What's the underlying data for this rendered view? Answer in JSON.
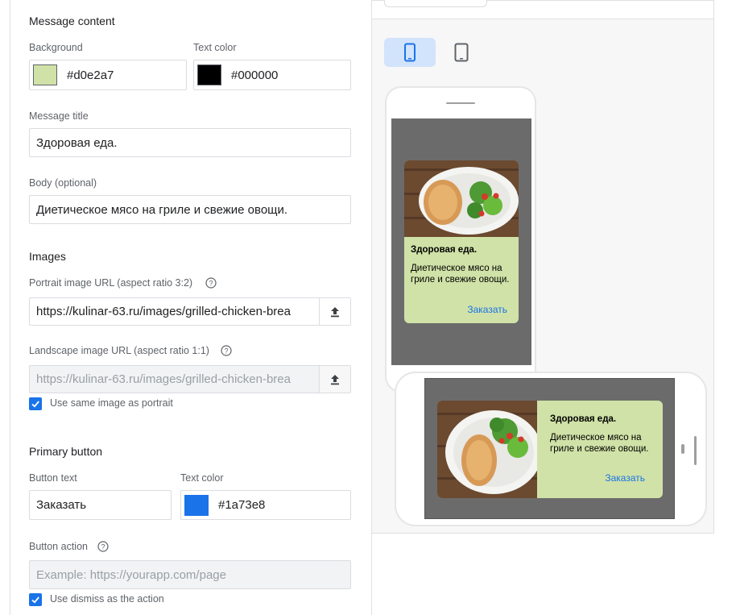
{
  "message_content": {
    "section_title": "Message content",
    "background_label": "Background",
    "background_value": "#d0e2a7",
    "text_color_label": "Text color",
    "text_color_value": "#000000",
    "title_label": "Message title",
    "title_value": "Здоровая еда.",
    "body_label": "Body (optional)",
    "body_value": "Диетическое мясо на гриле и свежие овощи."
  },
  "images": {
    "section_title": "Images",
    "portrait_label": "Portrait image URL (aspect ratio 3:2)",
    "portrait_value": "https://kulinar-63.ru/images/grilled-chicken-brea",
    "landscape_label": "Landscape image URL (aspect ratio 1:1)",
    "landscape_value": "https://kulinar-63.ru/images/grilled-chicken-brea",
    "same_image_label": "Use same image as portrait",
    "same_image_checked": true
  },
  "primary_button": {
    "section_title": "Primary button",
    "button_text_label": "Button text",
    "button_text_value": "Заказать",
    "text_color_label": "Text color",
    "text_color_value": "#1a73e8",
    "action_label": "Button action",
    "action_placeholder": "Example: https://yourapp.com/page",
    "dismiss_label": "Use dismiss as the action",
    "dismiss_checked": true
  },
  "preview": {
    "card_title": "Здоровая еда.",
    "card_body": "Диетическое мясо на гриле и свежие овощи.",
    "card_button": "Заказать",
    "selected_device": "phone-portrait"
  },
  "colors": {
    "accent": "#1a73e8",
    "card_bg": "#d0e2a7",
    "screen_overlay": "#6b6b6b"
  }
}
